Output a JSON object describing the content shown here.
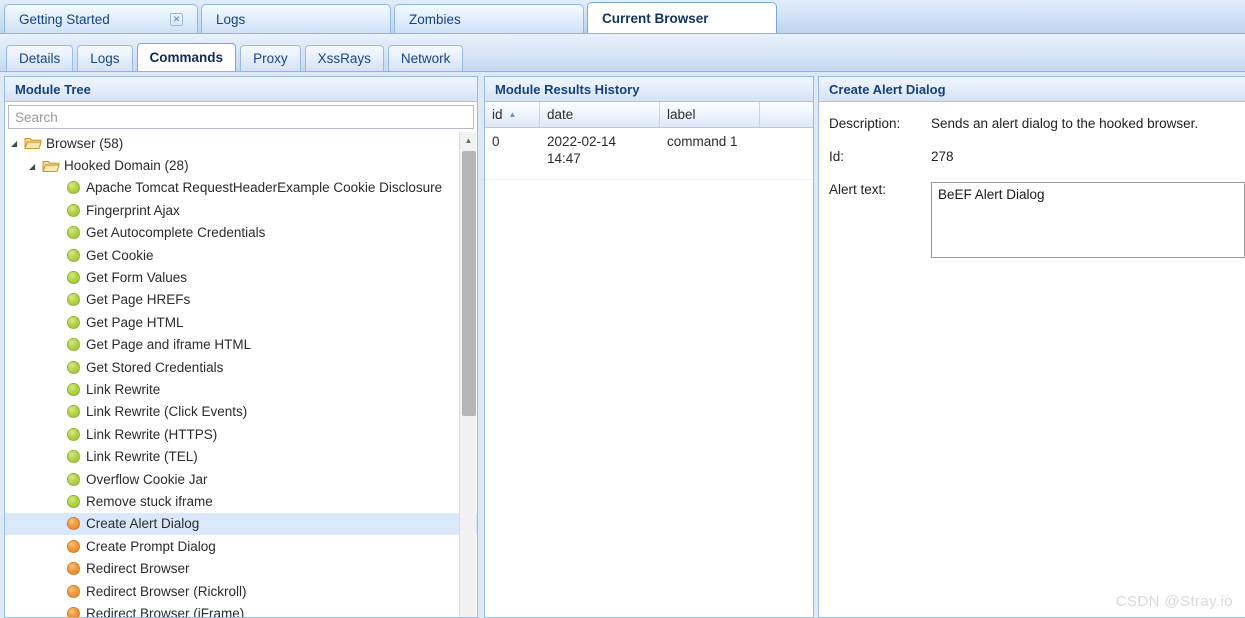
{
  "tabs": {
    "main": [
      {
        "label": "Getting Started",
        "active": false,
        "closable": true,
        "close_icon": "close-icon"
      },
      {
        "label": "Logs",
        "active": false,
        "closable": false
      },
      {
        "label": "Zombies",
        "active": false,
        "closable": false
      },
      {
        "label": "Current Browser",
        "active": true,
        "closable": false
      }
    ],
    "sub": [
      {
        "label": "Details",
        "active": false
      },
      {
        "label": "Logs",
        "active": false
      },
      {
        "label": "Commands",
        "active": true
      },
      {
        "label": "Proxy",
        "active": false
      },
      {
        "label": "XssRays",
        "active": false
      },
      {
        "label": "Network",
        "active": false
      }
    ]
  },
  "module_tree": {
    "title": "Module Tree",
    "search": {
      "value": "",
      "placeholder": "Search"
    },
    "scrollbar": {
      "up_icon": "chevron-up-icon"
    },
    "nodes": [
      {
        "type": "folder",
        "label": "Browser (58)",
        "indent": 0,
        "expanded": true,
        "icon": "folder-open-icon",
        "arrow_icon": "triangle-down-icon"
      },
      {
        "type": "folder",
        "label": "Hooked Domain (28)",
        "indent": 1,
        "expanded": true,
        "icon": "folder-open-icon",
        "arrow_icon": "triangle-down-icon"
      },
      {
        "type": "module",
        "label": "Apache Tomcat RequestHeaderExample Cookie Disclosure",
        "status": "green",
        "selected": false
      },
      {
        "type": "module",
        "label": "Fingerprint Ajax",
        "status": "green",
        "selected": false
      },
      {
        "type": "module",
        "label": "Get Autocomplete Credentials",
        "status": "green",
        "selected": false
      },
      {
        "type": "module",
        "label": "Get Cookie",
        "status": "green",
        "selected": false
      },
      {
        "type": "module",
        "label": "Get Form Values",
        "status": "green",
        "selected": false
      },
      {
        "type": "module",
        "label": "Get Page HREFs",
        "status": "green",
        "selected": false
      },
      {
        "type": "module",
        "label": "Get Page HTML",
        "status": "green",
        "selected": false
      },
      {
        "type": "module",
        "label": "Get Page and iframe HTML",
        "status": "green",
        "selected": false
      },
      {
        "type": "module",
        "label": "Get Stored Credentials",
        "status": "green",
        "selected": false
      },
      {
        "type": "module",
        "label": "Link Rewrite",
        "status": "green",
        "selected": false
      },
      {
        "type": "module",
        "label": "Link Rewrite (Click Events)",
        "status": "green",
        "selected": false
      },
      {
        "type": "module",
        "label": "Link Rewrite (HTTPS)",
        "status": "green",
        "selected": false
      },
      {
        "type": "module",
        "label": "Link Rewrite (TEL)",
        "status": "green",
        "selected": false
      },
      {
        "type": "module",
        "label": "Overflow Cookie Jar",
        "status": "green",
        "selected": false
      },
      {
        "type": "module",
        "label": "Remove stuck iframe",
        "status": "green",
        "selected": false
      },
      {
        "type": "module",
        "label": "Create Alert Dialog",
        "status": "orange",
        "selected": true
      },
      {
        "type": "module",
        "label": "Create Prompt Dialog",
        "status": "orange",
        "selected": false
      },
      {
        "type": "module",
        "label": "Redirect Browser",
        "status": "orange",
        "selected": false
      },
      {
        "type": "module",
        "label": "Redirect Browser (Rickroll)",
        "status": "orange",
        "selected": false
      },
      {
        "type": "module",
        "label": "Redirect Browser (iFrame)",
        "status": "orange",
        "selected": false
      }
    ]
  },
  "results_history": {
    "title": "Module Results History",
    "columns": [
      {
        "key": "id",
        "label": "id",
        "sorted": "asc",
        "sort_icon": "sort-asc-icon"
      },
      {
        "key": "date",
        "label": "date",
        "sorted": ""
      },
      {
        "key": "label",
        "label": "label",
        "sorted": ""
      }
    ],
    "rows": [
      {
        "id": "0",
        "date": "2022-02-14 14:47",
        "label": "command 1"
      }
    ]
  },
  "detail": {
    "title": "Create Alert Dialog",
    "fields": [
      {
        "label": "Description:",
        "value": "Sends an alert dialog to the hooked browser."
      },
      {
        "label": "Id:",
        "value": "278"
      }
    ],
    "alert_text": {
      "label": "Alert text:",
      "value": "BeEF Alert Dialog"
    }
  },
  "watermark": "CSDN @Stray.io",
  "colors": {
    "accent": "#16427c",
    "panel_border": "#99bbe8",
    "selection": "#d9e8fb",
    "status_green": "#b4d648",
    "status_orange": "#f39a3c"
  }
}
